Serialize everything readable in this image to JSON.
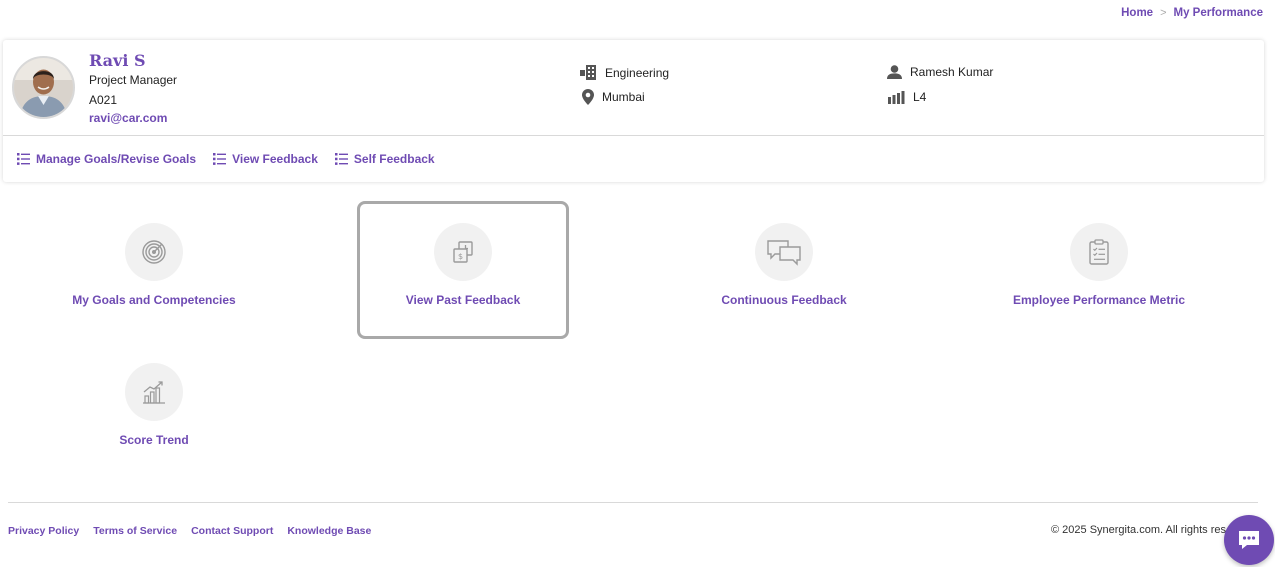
{
  "breadcrumb": {
    "home": "Home",
    "separator": ">",
    "current": "My Performance"
  },
  "profile": {
    "name": "Ravi S",
    "role": "Project Manager",
    "employee_id": "A021",
    "email": "ravi@car.com",
    "department": "Engineering",
    "location": "Mumbai",
    "manager": "Ramesh Kumar",
    "level": "L4"
  },
  "profile_links": [
    {
      "label": "Manage Goals/Revise Goals",
      "icon": "list-icon"
    },
    {
      "label": "View Feedback",
      "icon": "list-icon"
    },
    {
      "label": "Self Feedback",
      "icon": "list-icon"
    }
  ],
  "tiles": [
    {
      "label": "My Goals and Competencies",
      "icon": "target-icon"
    },
    {
      "label": "View Past Feedback",
      "icon": "past-feedback-icon",
      "active": true
    },
    {
      "label": "Continuous Feedback",
      "icon": "chat-bubbles-icon"
    },
    {
      "label": "Employee Performance Metric",
      "icon": "clipboard-icon"
    },
    {
      "label": "Score Trend",
      "icon": "trend-chart-icon"
    }
  ],
  "footer": {
    "links": [
      "Privacy Policy",
      "Terms of Service",
      "Contact Support",
      "Knowledge Base"
    ],
    "copyright": "© 2025 Synergita.com. All rights reserved."
  },
  "colors": {
    "accent": "#6f4bb3",
    "icon_gray": "#9a9a9a",
    "tile_circle": "#f1f1f1"
  }
}
